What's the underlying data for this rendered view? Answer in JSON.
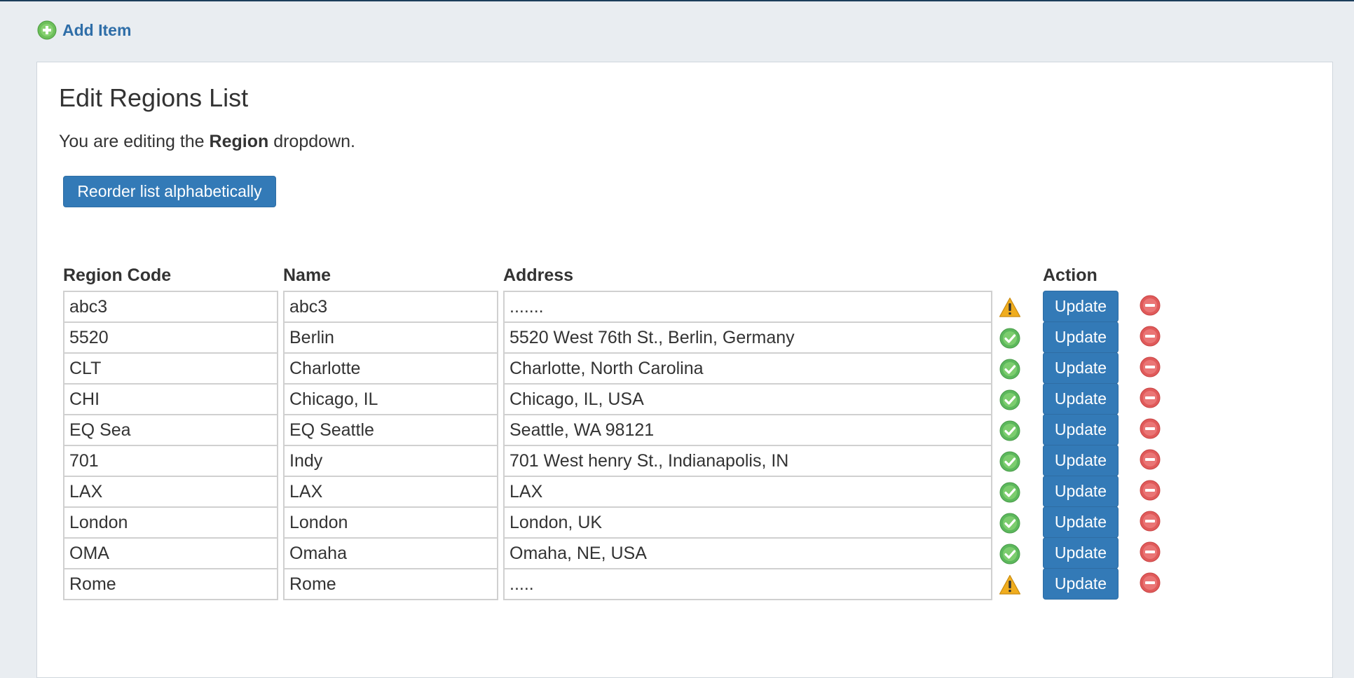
{
  "toolbar": {
    "add_item_label": "Add Item"
  },
  "panel": {
    "title": "Edit Regions List",
    "subtitle_prefix": "You are editing the ",
    "subtitle_bold": "Region",
    "subtitle_suffix": " dropdown.",
    "reorder_label": "Reorder list alphabetically"
  },
  "table": {
    "headers": {
      "code": "Region Code",
      "name": "Name",
      "address": "Address",
      "action": "Action"
    },
    "update_label": "Update",
    "rows": [
      {
        "code": "abc3",
        "name": "abc3",
        "address": ".......",
        "status": "warning-icon"
      },
      {
        "code": "5520",
        "name": "Berlin",
        "address": "5520 West 76th St., Berlin, Germany",
        "status": "check-icon"
      },
      {
        "code": "CLT",
        "name": "Charlotte",
        "address": "Charlotte, North Carolina",
        "status": "check-icon"
      },
      {
        "code": "CHI",
        "name": "Chicago, IL",
        "address": "Chicago, IL, USA",
        "status": "check-icon"
      },
      {
        "code": "EQ Sea",
        "name": "EQ Seattle",
        "address": "Seattle, WA 98121",
        "status": "check-icon"
      },
      {
        "code": "701",
        "name": "Indy",
        "address": "701 West henry St., Indianapolis, IN",
        "status": "check-icon"
      },
      {
        "code": "LAX",
        "name": "LAX",
        "address": "LAX",
        "status": "check-icon"
      },
      {
        "code": "London",
        "name": "London",
        "address": "London, UK",
        "status": "check-icon"
      },
      {
        "code": "OMA",
        "name": "Omaha",
        "address": "Omaha, NE, USA",
        "status": "check-icon"
      },
      {
        "code": "Rome",
        "name": "Rome",
        "address": ".....",
        "status": "warning-icon"
      }
    ]
  },
  "colors": {
    "primary": "#337ab7",
    "link": "#2f6ea8",
    "success": "#5cb85c",
    "warning": "#f0ad1e",
    "danger": "#e05a5a"
  }
}
